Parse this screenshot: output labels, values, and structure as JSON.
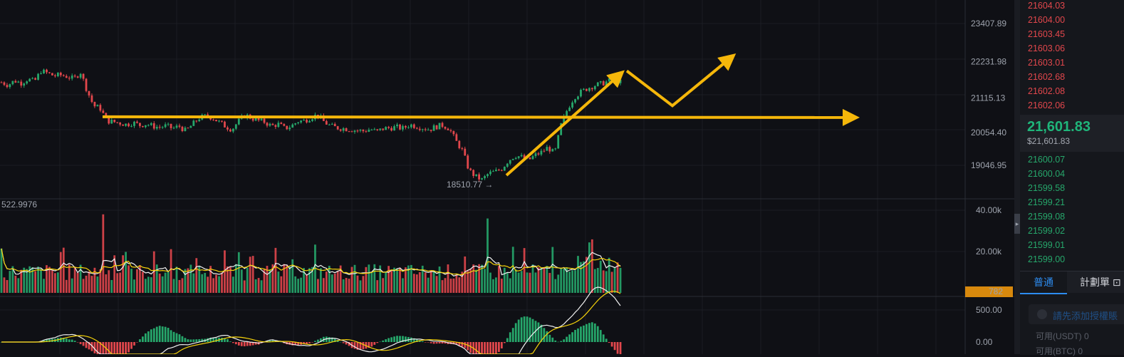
{
  "chart_data": {
    "type": "candlestick",
    "price_axis": [
      "23407.89",
      "22231.98",
      "21115.13",
      "20054.40",
      "19046.95"
    ],
    "volume_axis": [
      "40.00k",
      "20.00k"
    ],
    "macd_axis": [
      "500.00",
      "0.00"
    ],
    "low_marker": "18510.77",
    "volume_indicator_value": "522.9976",
    "current_volume_badge": "782",
    "colors": {
      "up": "#26a76b",
      "down": "#e2474c",
      "annotation": "#f5b70a",
      "ma_fast": "#f1f1f1",
      "ma_slow": "#f5d20a"
    },
    "price_series": [
      21600,
      21520,
      21650,
      21580,
      21700,
      21620,
      21950,
      21880,
      21800,
      21820,
      21780,
      21700,
      21920,
      21350,
      20880,
      20800,
      20420,
      20380,
      20350,
      20300,
      20360,
      20280,
      20320,
      20250,
      20220,
      20260,
      20180,
      20250,
      20100,
      20300,
      20500,
      20560,
      20520,
      20380,
      20250,
      20150,
      20400,
      20600,
      20500,
      20420,
      20380,
      20250,
      20320,
      20180,
      20250,
      20400,
      20420,
      20520,
      20600,
      20380,
      20250,
      20200,
      20180,
      20150,
      20120,
      20100,
      20160,
      20080,
      20180,
      20200,
      20220,
      20180,
      20300,
      20250,
      20200,
      20150,
      20240,
      20280,
      20180,
      19800,
      19500,
      18900,
      18700,
      18600,
      18800,
      18850,
      18950,
      19200,
      19350,
      19300,
      19200,
      19350,
      19450,
      19600,
      19400,
      20300,
      20800,
      21150,
      21300,
      21420,
      21500,
      21550,
      21620,
      21700,
      21602
    ]
  },
  "annotations": {
    "horizontal_level": 20540,
    "arrow_up_from": 18850,
    "arrow_up_to": 21950,
    "zigzag": [
      21950,
      20880,
      22320
    ]
  },
  "orderbook": {
    "asks": [
      "21604.03",
      "21604.00",
      "21603.45",
      "21603.06",
      "21603.01",
      "21602.68",
      "21602.08",
      "21602.06"
    ],
    "last_price": "21,601.83",
    "last_price_usd": "$21,601.83",
    "bids": [
      "21600.07",
      "21600.04",
      "21599.58",
      "21599.21",
      "21599.08",
      "21599.02",
      "21599.01",
      "21599.00"
    ]
  },
  "order_panel": {
    "tab_normal": "普通",
    "tab_plan": "計劃單",
    "hint": "請先添加授權賬",
    "available_usdt_label": "可用(USDT)",
    "available_usdt_value": "0",
    "available_btc_label": "可用(BTC)",
    "available_btc_value": "0"
  }
}
